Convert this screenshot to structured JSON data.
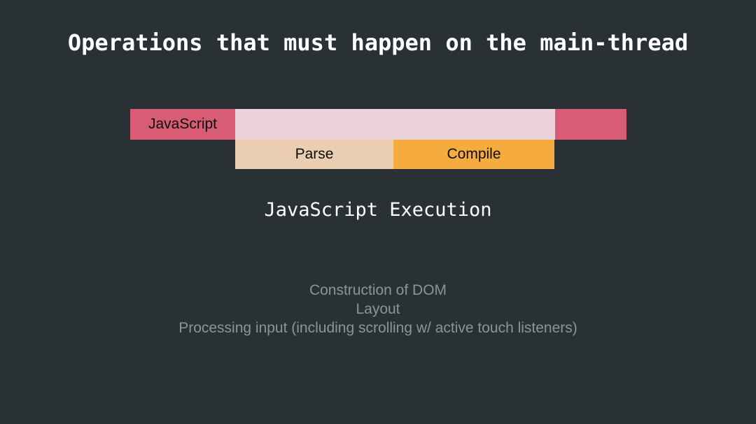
{
  "slide": {
    "title": "Operations that must happen on the main-thread",
    "background_color": "#2a3134",
    "title_color": "#ffffff"
  },
  "diagram": {
    "caption": "JavaScript Execution",
    "caption_color": "#ffffff",
    "top_row": {
      "javascript_label": "JavaScript",
      "javascript_color": "#d85d74",
      "javascript_inner_color": "#ecd2da"
    },
    "bottom_row": {
      "parse_label": "Parse",
      "parse_color": "#ebcdb1",
      "compile_label": "Compile",
      "compile_color": "#f5ab3e"
    }
  },
  "notes": {
    "color": "#8d9396",
    "lines": [
      "Construction of DOM",
      "Layout",
      "Processing input (including scrolling w/ active touch listeners)"
    ]
  },
  "chart_data": {
    "type": "bar",
    "title": "JavaScript Execution",
    "orientation": "horizontal",
    "stacked": true,
    "xlabel": "",
    "ylabel": "",
    "series": [
      {
        "name": "JavaScript",
        "row": 1,
        "label": "JavaScript",
        "color": "#d85d74",
        "start": 0,
        "end": 709,
        "labelled_span": [
          0,
          150
        ],
        "inner_span": [
          150,
          607
        ],
        "inner_color": "#ecd2da"
      },
      {
        "name": "Parse",
        "row": 2,
        "label": "Parse",
        "color": "#ebcdb1",
        "start": 150,
        "end": 376
      },
      {
        "name": "Compile",
        "row": 2,
        "label": "Compile",
        "color": "#f5ab3e",
        "start": 376,
        "end": 606
      }
    ],
    "legend": false,
    "grid": false
  }
}
